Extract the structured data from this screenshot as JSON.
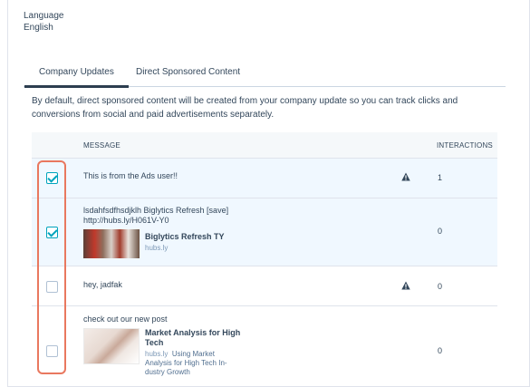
{
  "language": {
    "label": "Language",
    "value": "English"
  },
  "tabs": [
    {
      "label": "Company Updates",
      "active": true
    },
    {
      "label": "Direct Sponsored Content",
      "active": false
    }
  ],
  "description": "By default, direct sponsored content will be created from your company update so you can track clicks and conversions from social and paid advertisements separately.",
  "table": {
    "col_message": "MESSAGE",
    "col_interactions": "INTERACTIONS",
    "rows": [
      {
        "checked": true,
        "message": "This is from the Ads user!!",
        "warning": true,
        "interactions": "1"
      },
      {
        "checked": true,
        "message_line1": "lsdahfsdfhsdjklh Biglytics Refresh [save]",
        "message_line2": "http://hubs.ly/H061V-Y0",
        "card_title": "Biglytics Refresh TY",
        "card_domain": "hubs.ly",
        "interactions": "0"
      },
      {
        "checked": false,
        "message": "hey, jadfak",
        "warning": true,
        "interactions": "0"
      },
      {
        "checked": false,
        "message": "check out our new post",
        "card_title_line1": "Market Analysis for High",
        "card_title_line2": "Tech",
        "card_domain": "hubs.ly",
        "card_desc_line1": "Using Market",
        "card_desc_line2": "Analysis for High Tech In-",
        "card_desc_line3": "dustry Growth",
        "interactions": "0"
      }
    ]
  },
  "colors": {
    "accent": "#00a4bd",
    "highlight": "#e9785f",
    "tab_underline": "#2d3e50"
  }
}
